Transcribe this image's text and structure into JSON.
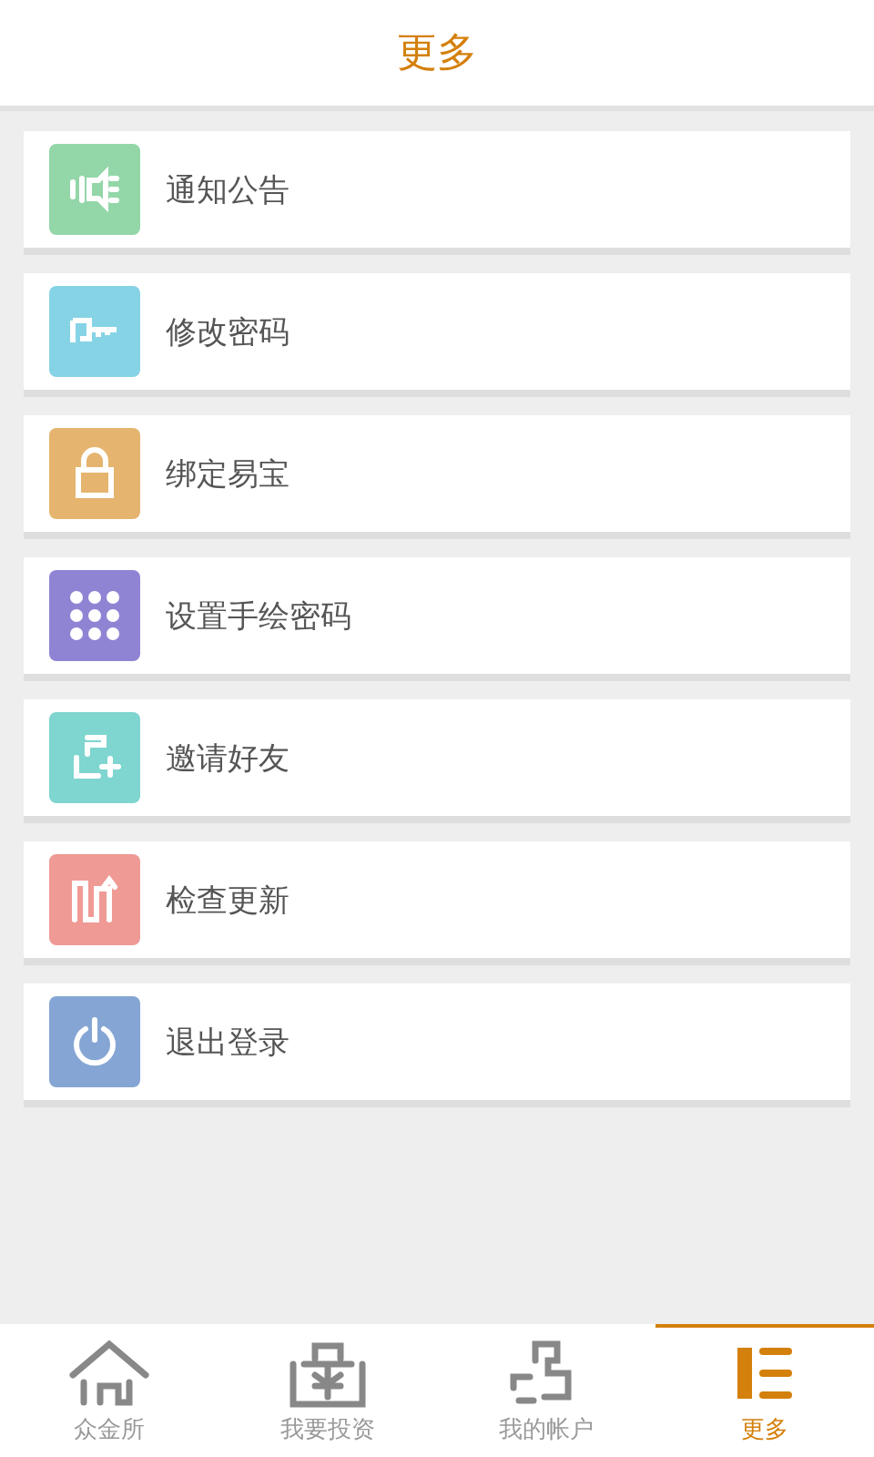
{
  "header": {
    "title": "更多"
  },
  "menu": [
    {
      "kind": "speaker",
      "label": "通知公告",
      "color": "#93d6a8"
    },
    {
      "kind": "key",
      "label": "修改密码",
      "color": "#86d3e6"
    },
    {
      "kind": "lock",
      "label": "绑定易宝",
      "color": "#e5b46e"
    },
    {
      "kind": "dots",
      "label": "设置手绘密码",
      "color": "#8f84d4"
    },
    {
      "kind": "invite",
      "label": "邀请好友",
      "color": "#7fd5cf"
    },
    {
      "kind": "update",
      "label": "检查更新",
      "color": "#ef9a95"
    },
    {
      "kind": "power",
      "label": "退出登录",
      "color": "#85a6d4"
    }
  ],
  "tabs": [
    {
      "kind": "home",
      "label": "众金所",
      "selected": false
    },
    {
      "kind": "invest",
      "label": "我要投资",
      "selected": false
    },
    {
      "kind": "account",
      "label": "我的帐户",
      "selected": false
    },
    {
      "kind": "more",
      "label": "更多",
      "selected": true
    }
  ]
}
